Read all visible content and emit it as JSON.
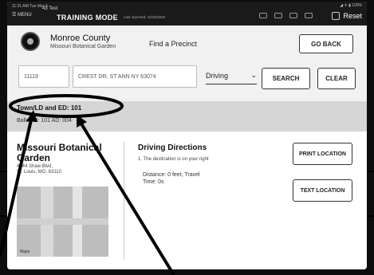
{
  "status_bar": {
    "time": "11:31 AM  Tue Mar 3",
    "menu_label": "☰ MENU",
    "test_label": "43 Test",
    "mode_label": "TRAINING MODE",
    "imported_text": "Last imported: 12/26/2020",
    "system_status": "◢ ✈ ▮ 100%",
    "reset_label": "Reset"
  },
  "header": {
    "county_name": "Monroe County",
    "subtitle": "Missouri Botanical Garden",
    "page_title": "Find a Precinct",
    "go_back_label": "GO BACK"
  },
  "search": {
    "house_number": "11119",
    "street": "CREST DR, ST ANN NY 63074",
    "mode": "Driving",
    "search_label": "SEARCH",
    "clear_label": "CLEAR"
  },
  "precinct": {
    "town_ld_ed": "Town/LD and ED: 101",
    "ballot_id": "Ballot ID: 101  AD: 004"
  },
  "location": {
    "name": "Missouri Botanical Garden",
    "address_line1": "4344 Shaw Blvd,",
    "address_line2": "St. Louis, MO, 63110",
    "maps_label": "Maps"
  },
  "directions": {
    "title": "Driving Directions",
    "step1": "1. The destination is on your right",
    "distance": "Distance: 0 feet, Travel",
    "time": "Time: 0s",
    "print_label": "PRINT LOCATION",
    "text_label": "TEXT LOCATION"
  }
}
